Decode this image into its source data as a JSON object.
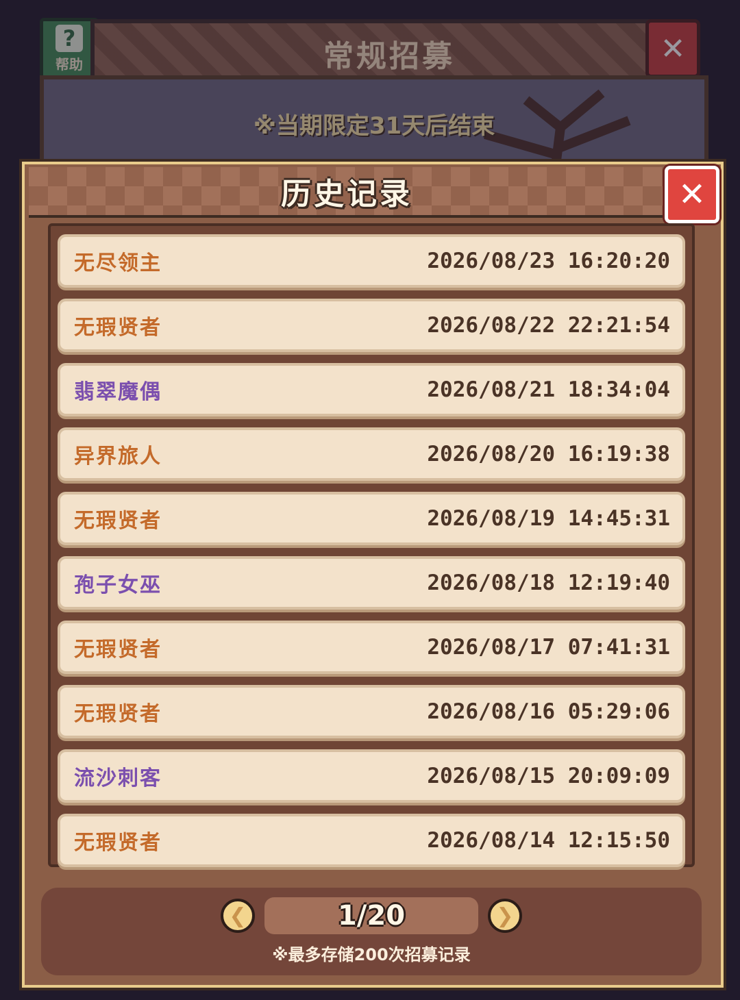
{
  "background": {
    "title": "常规招募",
    "help_label": "帮助",
    "close_glyph": "✕",
    "notice": "※当期限定31天后结束"
  },
  "modal": {
    "title": "历史记录",
    "close_glyph": "✕"
  },
  "colors": {
    "orange_name": "#c46a2a",
    "purple_name": "#7b4fae"
  },
  "records": [
    {
      "name": "无尽领主",
      "time": "2026/08/23 16:20:20",
      "color": "#c46a2a"
    },
    {
      "name": "无瑕贤者",
      "time": "2026/08/22 22:21:54",
      "color": "#c46a2a"
    },
    {
      "name": "翡翠魔偶",
      "time": "2026/08/21 18:34:04",
      "color": "#7b4fae"
    },
    {
      "name": "异界旅人",
      "time": "2026/08/20 16:19:38",
      "color": "#c46a2a"
    },
    {
      "name": "无瑕贤者",
      "time": "2026/08/19 14:45:31",
      "color": "#c46a2a"
    },
    {
      "name": "孢子女巫",
      "time": "2026/08/18 12:19:40",
      "color": "#7b4fae"
    },
    {
      "name": "无瑕贤者",
      "time": "2026/08/17 07:41:31",
      "color": "#c46a2a"
    },
    {
      "name": "无瑕贤者",
      "time": "2026/08/16 05:29:06",
      "color": "#c46a2a"
    },
    {
      "name": "流沙刺客",
      "time": "2026/08/15 20:09:09",
      "color": "#7b4fae"
    },
    {
      "name": "无瑕贤者",
      "time": "2026/08/14 12:15:50",
      "color": "#c46a2a"
    }
  ],
  "pagination": {
    "page_text": "1/20",
    "prev_glyph": "❮",
    "next_glyph": "❯"
  },
  "footer_note": "※最多存储200次招募记录"
}
